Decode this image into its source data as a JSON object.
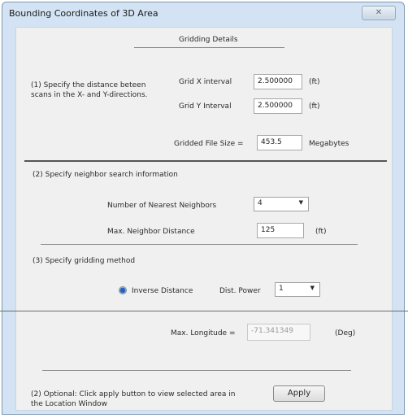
{
  "window": {
    "title": "Bounding Coordinates of 3D Area",
    "close_glyph": "✕"
  },
  "gridding": {
    "heading": "Gridding Details",
    "instruction_line1": "(1) Specify the distance beteen",
    "instruction_line2": "scans in the X- and Y-directions.",
    "grid_x_label": "Grid X interval",
    "grid_x_value": "2.500000",
    "grid_x_unit": "(ft)",
    "grid_y_label": "Grid Y Interval",
    "grid_y_value": "2.500000",
    "grid_y_unit": "(ft)",
    "file_size_label": "Gridded File Size =",
    "file_size_value": "453.5",
    "file_size_unit": "Megabytes"
  },
  "neighbor": {
    "heading": "(2) Specify neighbor search information",
    "nearest_label": "Number of Nearest Neighbors",
    "nearest_value": "4",
    "max_dist_label": "Max. Neighbor Distance",
    "max_dist_value": "125",
    "max_dist_unit": "(ft)"
  },
  "method": {
    "heading": "(3) Specify gridding method",
    "option_label": "Inverse Distance",
    "power_label": "Dist. Power",
    "power_value": "1"
  },
  "longitude": {
    "label": "Max. Longitude =",
    "value": "-71.341349",
    "unit": "(Deg)"
  },
  "apply": {
    "text_line1": "(2) Optional: Click apply button to view selected area in",
    "text_line2": "the Location Window",
    "button_label": "Apply"
  },
  "colors": {
    "window_frame": "#d3e3f3",
    "panel": "#f0f0f0",
    "radio_dot": "#2a62b8"
  }
}
